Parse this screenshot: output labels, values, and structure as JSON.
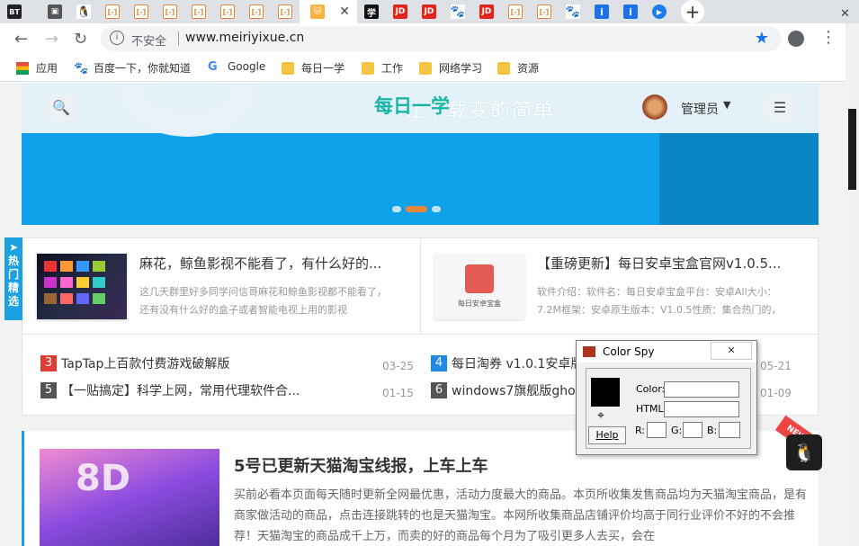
{
  "browser": {
    "tabs": [
      {
        "icon": "bt",
        "text": "BT"
      },
      {
        "icon": "square",
        "text": "▣"
      },
      {
        "icon": "qq",
        "text": "🐧"
      },
      {
        "icon": "bracket",
        "text": "[-]"
      },
      {
        "icon": "bracket",
        "text": "[-]"
      },
      {
        "icon": "bracket",
        "text": "[-]"
      },
      {
        "icon": "bracket",
        "text": "[-]"
      },
      {
        "icon": "bracket",
        "text": "[-]"
      },
      {
        "icon": "bracket",
        "text": "[-]"
      },
      {
        "icon": "cat",
        "text": "🐱"
      },
      {
        "icon": "xue",
        "text": "学"
      },
      {
        "icon": "jd",
        "text": "JD"
      },
      {
        "icon": "jd",
        "text": "JD"
      },
      {
        "icon": "paw",
        "text": "🐾"
      },
      {
        "icon": "jd",
        "text": "JD"
      },
      {
        "icon": "bracket",
        "text": "[-]"
      },
      {
        "icon": "bracket",
        "text": "[-]"
      },
      {
        "icon": "paw",
        "text": "🐾"
      },
      {
        "icon": "info",
        "text": "i"
      },
      {
        "icon": "info",
        "text": "i"
      },
      {
        "icon": "camera",
        "text": "▶"
      }
    ],
    "active_tab_close": "✕",
    "new_tab": "+",
    "window_close": "✕",
    "nav": {
      "back": "←",
      "forward": "→",
      "reload": "↻"
    },
    "address": {
      "info_icon": "i",
      "insecure": "不安全",
      "url": "www.meiriyixue.cn",
      "star": "★"
    },
    "menu": "⋮",
    "bookmarks": [
      {
        "icon": "apps",
        "label": "应用"
      },
      {
        "icon": "paw",
        "label": "百度一下，你就知道"
      },
      {
        "icon": "google",
        "label": "Google"
      },
      {
        "icon": "folder",
        "label": "每日一学"
      },
      {
        "icon": "folder",
        "label": "工作"
      },
      {
        "icon": "folder",
        "label": "网络学习"
      },
      {
        "icon": "folder",
        "label": "资源"
      }
    ]
  },
  "site": {
    "header": {
      "search_icon": "🔍",
      "logo": "每日一学",
      "slogan": "让下载变的简单",
      "username": "管理员",
      "caret": "▼",
      "menu_icon": "☰"
    },
    "side_hot": "热门精选",
    "cards": [
      {
        "title": "麻花，鲸鱼影视不能看了，有什么好的...",
        "desc": "这几天群里好多同学问信哥麻花和鲸鱼影视都不能看了，还有没有什么好的盒子或者智能电视上用的影视"
      },
      {
        "title": "【重磅更新】每日安卓宝盒官网v1.0.5...",
        "desc": "软件介绍：软件名：每日安卓宝盒平台：安卓All大小：7.2M框架：安卓原生版本：V1.0.5性质：集合热门的，",
        "thumb_label": "每日安卓宝盒"
      }
    ],
    "list": [
      {
        "num": "3",
        "color": "#e03c31",
        "title": "TapTap上百款付费游戏破解版",
        "date": "03-25"
      },
      {
        "num": "4",
        "color": "#1e88e5",
        "title": "每日淘券 v1.0.1安卓版",
        "date": "05-21"
      },
      {
        "num": "5",
        "color": "#555555",
        "title": "【一贴搞定】科学上网，常用代理软件合...",
        "date": "01-15"
      },
      {
        "num": "6",
        "color": "#555555",
        "title": "windows7旗舰版ghost",
        "date": "01-09"
      }
    ],
    "post": {
      "thumb_text": "8D",
      "title": "5号已更新天猫淘宝线报，上车上车",
      "desc": "买前必看本页面每天随时更新全网最优惠，活动力度最大的商品。本页所收集发售商品均为天猫淘宝商品，是有商家做活动的商品，点击连接跳转的也是天猫淘宝。本网所收集商品店铺评价均高于同行业评价不好的不会推荐！天猫淘宝的商品成千上万，而卖的好的商品每个月为了吸引更多人去买，会在",
      "badge": "NEW"
    },
    "float_qq": "🐧"
  },
  "colorspy": {
    "title": "Color Spy",
    "close": "✕",
    "crosshair": "⌖",
    "help": "Help",
    "color_label": "Color:",
    "html_label": "HTML:",
    "r_label": "R:",
    "g_label": "G:",
    "b_label": "B:",
    "swatch_color": "#000000"
  }
}
